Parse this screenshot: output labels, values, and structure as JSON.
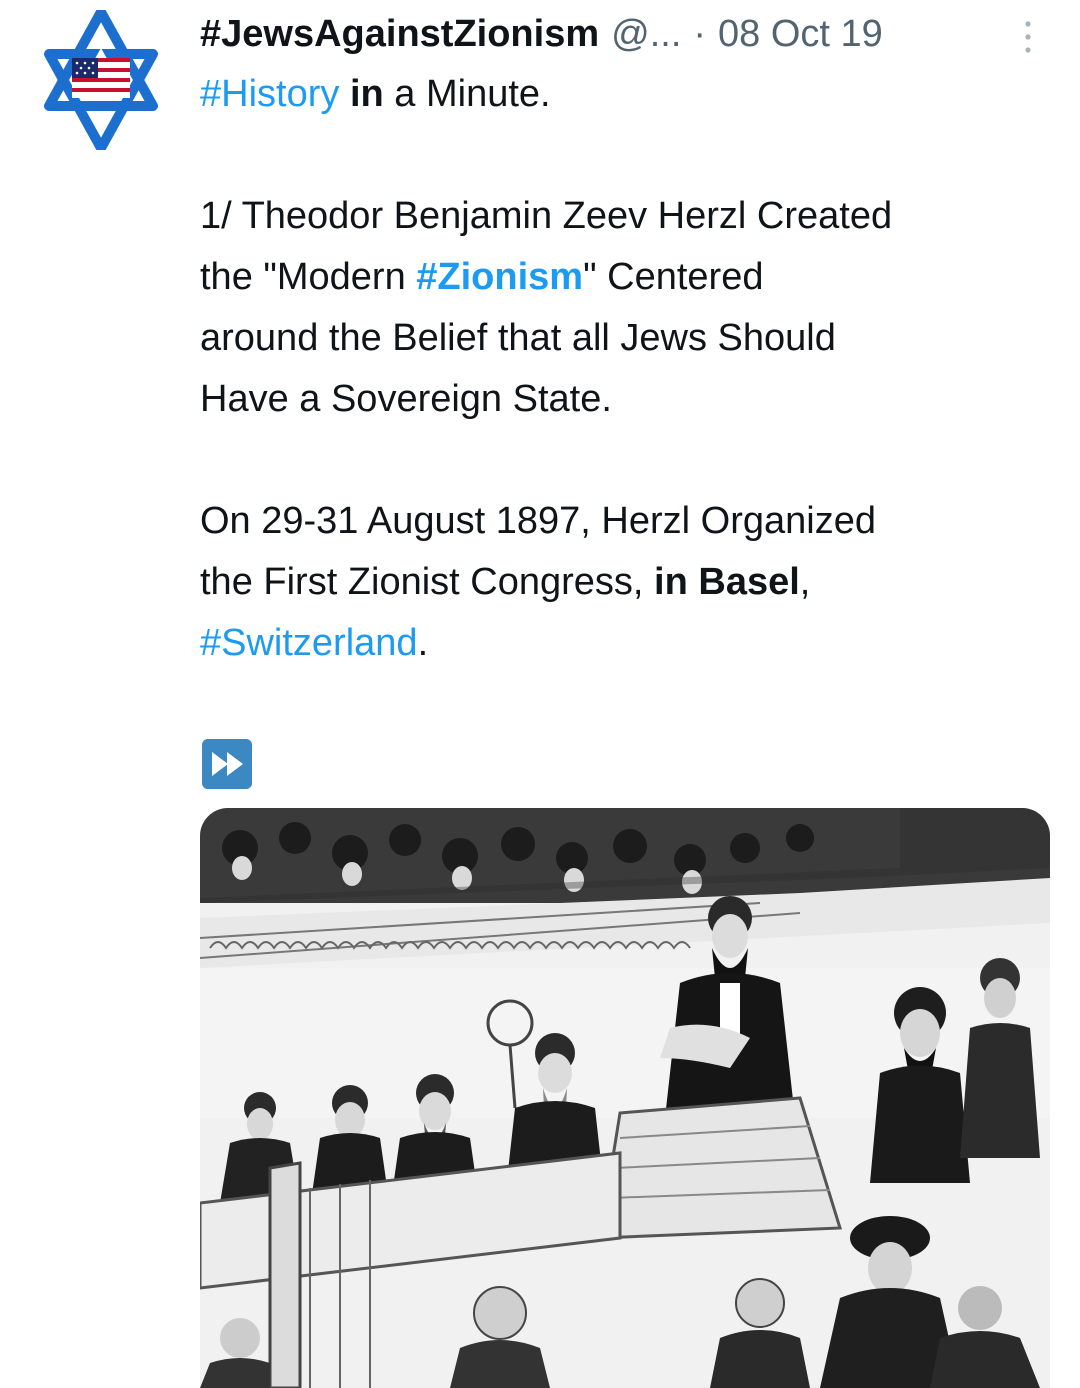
{
  "tweet": {
    "author_name": "#JewsAgainstZionism",
    "handle": "@...",
    "separator": "·",
    "date": "08 Oct 19",
    "line1": {
      "tag": "#History",
      "bold": "in",
      "rest": "a Minute."
    },
    "para1": {
      "t1": "1/ Theodor Benjamin Zeev Herzl Created",
      "t2": "the \"Modern ",
      "tag": "#Zionism",
      "t3": "\" Centered",
      "t4": "around the Belief that all Jews Should",
      "t5": "Have a Sovereign State."
    },
    "para2": {
      "t1": "On 29-31 August 1897, Herzl Organized",
      "t2": "the First Zionist Congress, ",
      "bold": "in Basel",
      "t3": ",",
      "tag": "#Switzerland",
      "t4": "."
    }
  },
  "icons": {
    "avatar": "star-of-david-us-flag-icon",
    "more": "vertical-ellipsis-icon",
    "fast_forward": "fast-forward-emoji-icon"
  },
  "media": {
    "image": "engraving-first-zionist-congress-herzl-speaking"
  },
  "colors": {
    "link": "#1d9bf0",
    "text": "#0f1419",
    "muted": "#536471",
    "emoji_blue": "#3b88c3",
    "star_blue": "#1c6fcf"
  }
}
